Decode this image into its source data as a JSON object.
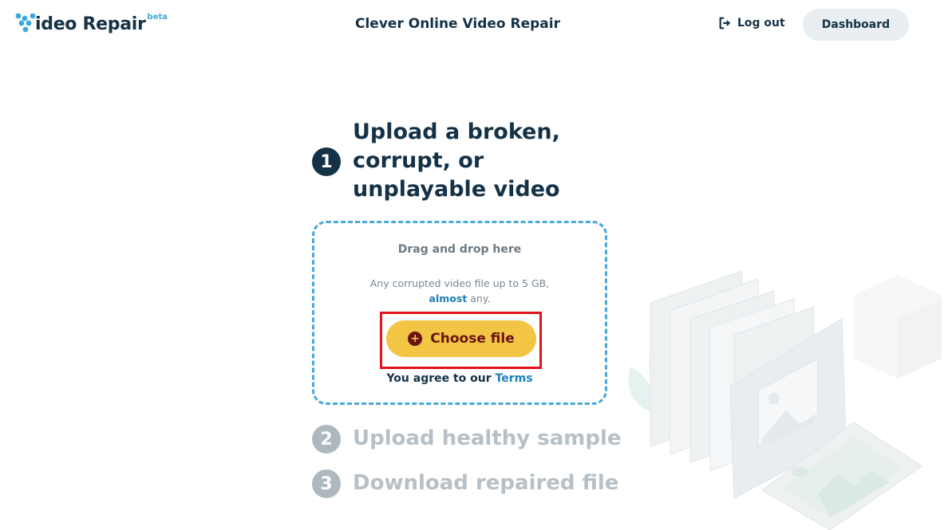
{
  "header": {
    "logo_text": "ideo Repair",
    "logo_badge": "beta",
    "title": "Clever Online Video Repair",
    "logout_label": "Log out",
    "dashboard_label": "Dashboard"
  },
  "steps": [
    {
      "number": "1",
      "label": "Upload a broken, corrupt, or unplayable video",
      "state": "active"
    },
    {
      "number": "2",
      "label": "Upload healthy sample",
      "state": "inactive"
    },
    {
      "number": "3",
      "label": "Download repaired file",
      "state": "inactive"
    }
  ],
  "dropzone": {
    "title": "Drag and drop here",
    "desc_line1": "Any corrupted video file up to 5 GB,",
    "desc_almost": "almost",
    "desc_any": " any.",
    "choose_label": "Choose file",
    "agree_text": "You agree to our ",
    "terms_link": "Terms"
  },
  "colors": {
    "primary": "#143247",
    "accent": "#f3c545",
    "link": "#1f7fb8",
    "dashed_border": "#45a9d9",
    "highlight": "#e3131b"
  },
  "icons": {
    "logout": "logout-icon",
    "plus": "plus-circle-icon"
  }
}
